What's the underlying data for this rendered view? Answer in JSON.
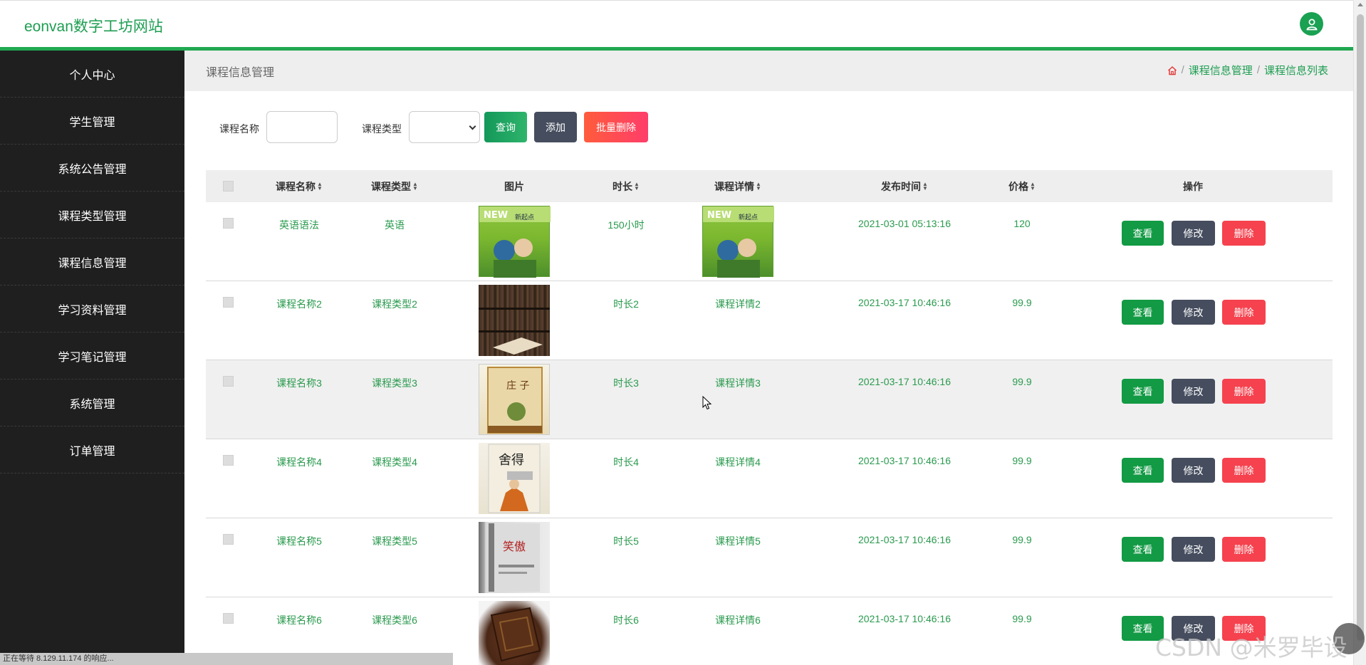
{
  "brand": "eonvan数字工坊网站",
  "sidebar": {
    "items": [
      {
        "label": "个人中心"
      },
      {
        "label": "学生管理"
      },
      {
        "label": "系统公告管理"
      },
      {
        "label": "课程类型管理"
      },
      {
        "label": "课程信息管理"
      },
      {
        "label": "学习资料管理"
      },
      {
        "label": "学习笔记管理"
      },
      {
        "label": "系统管理"
      },
      {
        "label": "订单管理"
      }
    ]
  },
  "page": {
    "title": "课程信息管理",
    "breadcrumb": [
      "课程信息管理",
      "课程信息列表"
    ],
    "breadcrumb_sep": "/"
  },
  "search": {
    "name_label": "课程名称",
    "name_value": "",
    "type_label": "课程类型",
    "type_value": "",
    "query": "查询",
    "add": "添加",
    "batch_delete": "批量删除"
  },
  "table": {
    "columns": [
      "课程名称",
      "课程类型",
      "图片",
      "时长",
      "课程详情",
      "发布时间",
      "价格",
      "操作"
    ],
    "rows": [
      {
        "name": "英语语法",
        "type": "英语",
        "image": "book-cover-english",
        "duration": "150小时",
        "detail_image": "book-cover-english",
        "time": "2021-03-01 05:13:16",
        "price": "120"
      },
      {
        "name": "课程名称2",
        "type": "课程类型2",
        "image": "bookshelf-photo",
        "duration": "时长2",
        "detail": "课程详情2",
        "time": "2021-03-17 10:46:16",
        "price": "99.9"
      },
      {
        "name": "课程名称3",
        "type": "课程类型3",
        "image": "book-cover-zhuangzi",
        "duration": "时长3",
        "detail": "课程详情3",
        "time": "2021-03-17 10:46:16",
        "price": "99.9"
      },
      {
        "name": "课程名称4",
        "type": "课程类型4",
        "image": "book-cover-monk",
        "duration": "时长4",
        "detail": "课程详情4",
        "time": "2021-03-17 10:46:16",
        "price": "99.9"
      },
      {
        "name": "课程名称5",
        "type": "课程类型5",
        "image": "book-cover-grey",
        "duration": "时长5",
        "detail": "课程详情5",
        "time": "2021-03-17 10:46:16",
        "price": "99.9"
      },
      {
        "name": "课程名称6",
        "type": "课程类型6",
        "image": "old-book-photo",
        "duration": "时长6",
        "detail": "课程详情6",
        "time": "2021-03-17 10:46:16",
        "price": "99.9"
      }
    ],
    "actions": {
      "view": "查看",
      "edit": "修改",
      "delete": "删除"
    }
  },
  "statusbar": "正在等待 8.129.11.174 的响应...",
  "watermark": "CSDN @米罗毕设",
  "colors": {
    "accent": "#21a851",
    "sidebar": "#1f1f1f",
    "edit": "#454d5e",
    "delete": "#f5424e"
  },
  "icons": {
    "avatar": "user-icon",
    "home": "home-icon",
    "sort": "sort-icon"
  }
}
